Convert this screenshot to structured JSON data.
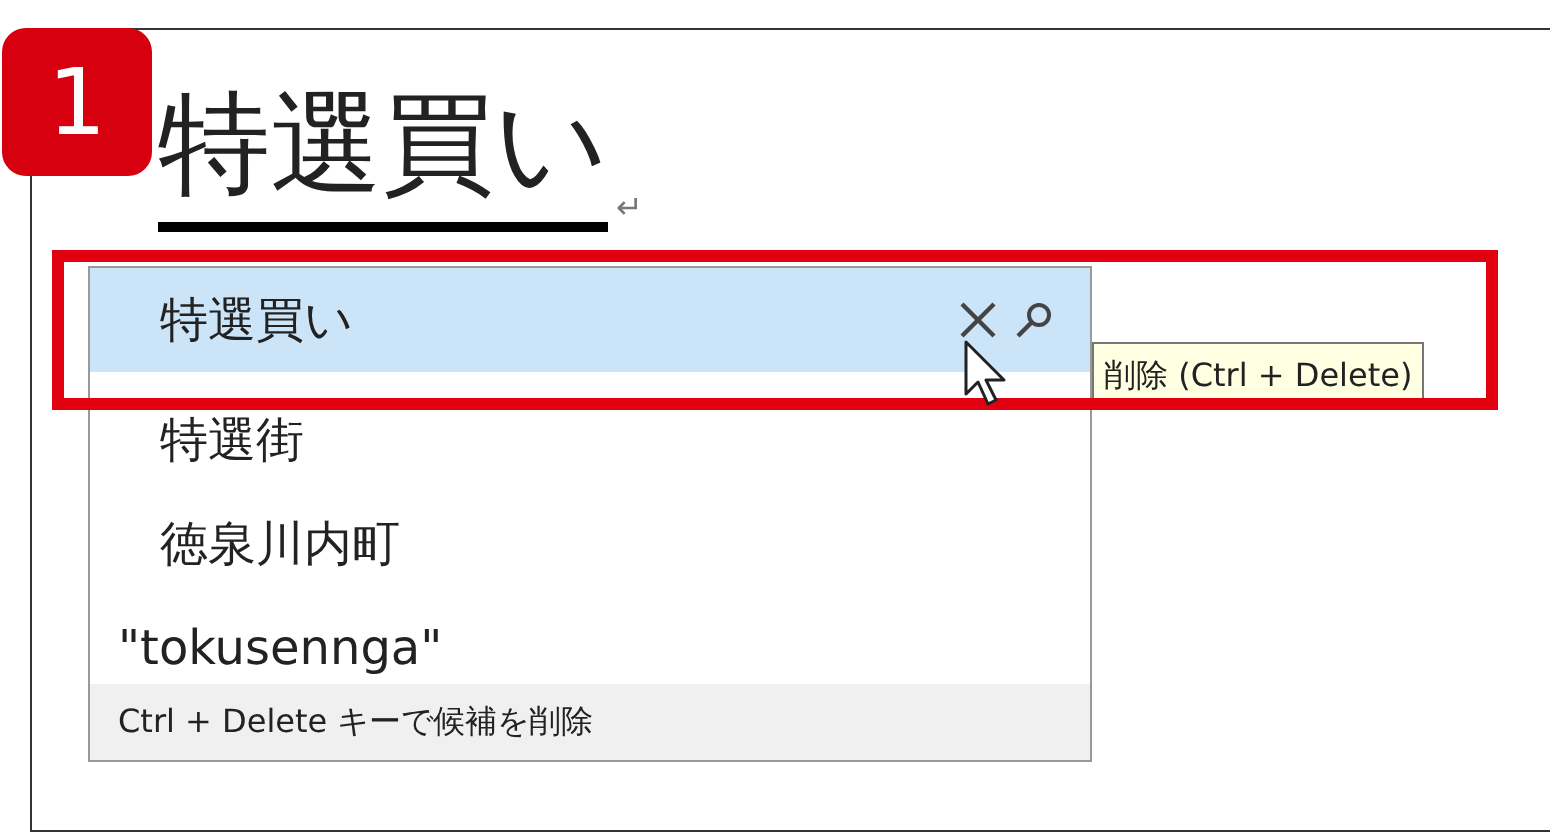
{
  "badge": "1",
  "composition": {
    "text": "特選買い",
    "paragraph_mark": "↵"
  },
  "candidates": [
    {
      "text": "特選買い",
      "selected": true,
      "kind": "candidate"
    },
    {
      "text": "特選街",
      "selected": false,
      "kind": "candidate"
    },
    {
      "text": "徳泉川内町",
      "selected": false,
      "kind": "candidate"
    },
    {
      "text": "\"tokusennga\"",
      "selected": false,
      "kind": "reading"
    }
  ],
  "footer": "Ctrl + Delete キーで候補を削除",
  "tooltip": "削除 (Ctrl + Delete)"
}
